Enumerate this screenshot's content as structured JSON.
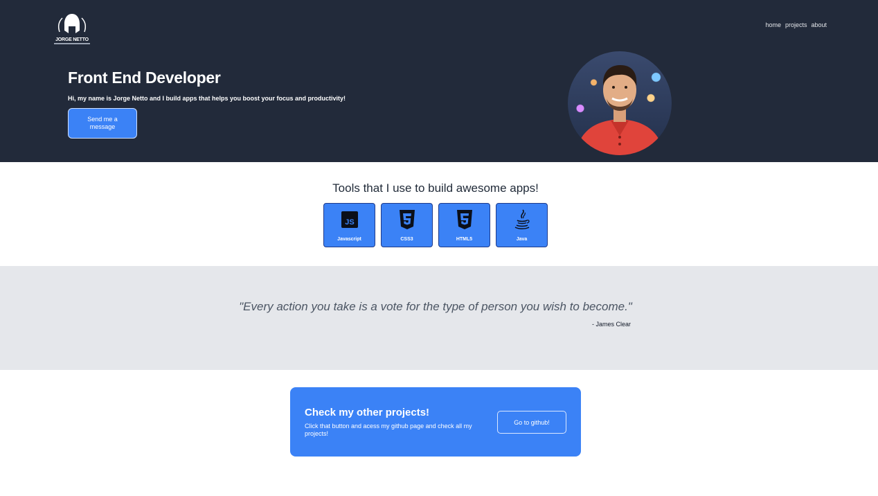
{
  "brand": {
    "logo_text": "JORGE NETTO"
  },
  "nav": {
    "items": [
      "home",
      "projects",
      "about"
    ]
  },
  "hero": {
    "title": "Front End Developer",
    "subtitle": "Hi, my name is Jorge Netto and I build apps that helps you boost your focus and productivity!",
    "cta_label": "Send me a message"
  },
  "tools": {
    "title": "Tools that I use to build awesome apps!",
    "items": [
      {
        "label": "Javascript",
        "icon": "javascript-icon"
      },
      {
        "label": "CSS3",
        "icon": "css3-icon"
      },
      {
        "label": "HTML5",
        "icon": "html5-icon"
      },
      {
        "label": "Java",
        "icon": "java-icon"
      }
    ]
  },
  "quote": {
    "text": "\"Every action you take is a vote for the type of person you wish to become.\"",
    "author": "- James Clear"
  },
  "projects": {
    "title": "Check my other projects!",
    "text": "Click that button and acess my github page and check all my projects!",
    "button_label": "Go to github!"
  },
  "colors": {
    "hero_bg": "#222a3a",
    "accent": "#3b82f6",
    "quote_bg": "#e5e7eb"
  }
}
